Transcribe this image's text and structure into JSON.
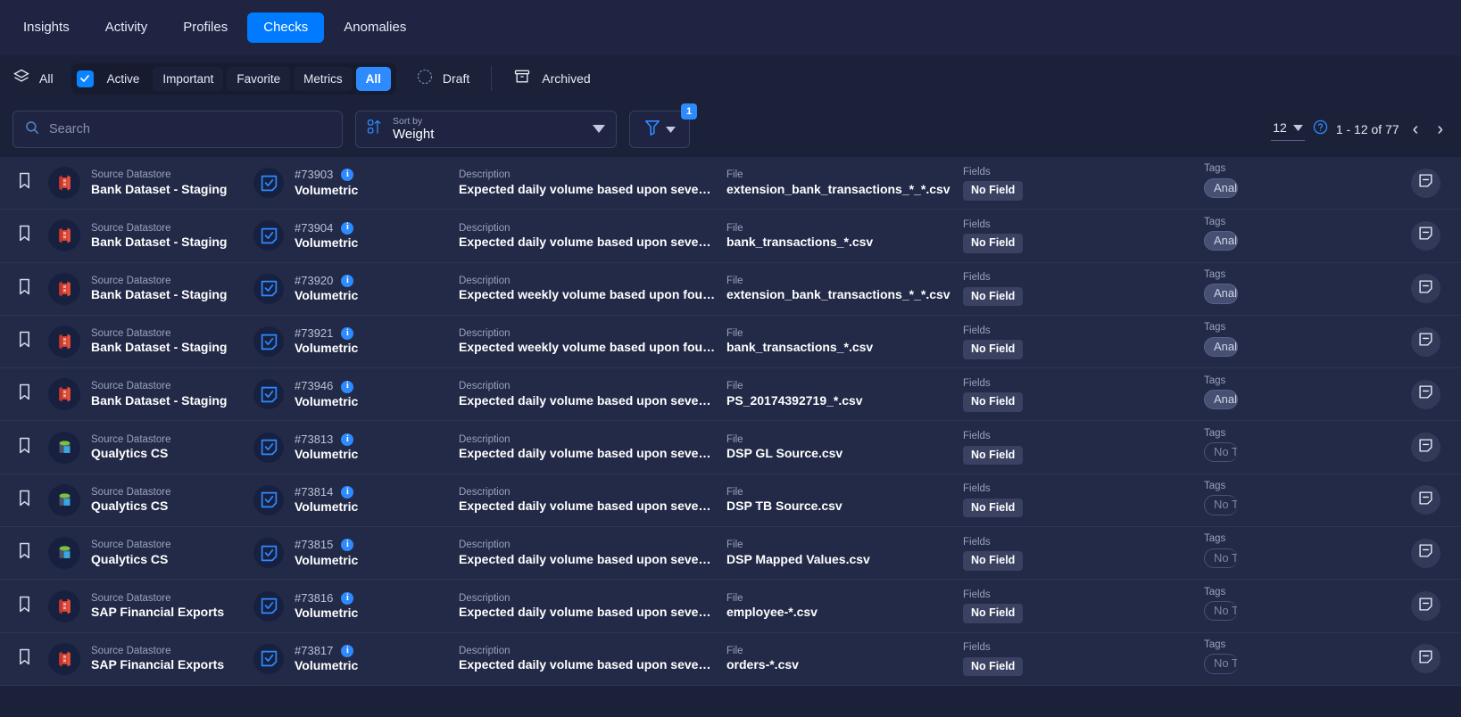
{
  "nav": {
    "tabs": [
      {
        "label": "Insights",
        "active": false
      },
      {
        "label": "Activity",
        "active": false
      },
      {
        "label": "Profiles",
        "active": false
      },
      {
        "label": "Checks",
        "active": true
      },
      {
        "label": "Anomalies",
        "active": false
      }
    ]
  },
  "filterbar": {
    "all_label": "All",
    "segment": [
      "Active",
      "Important",
      "Favorite",
      "Metrics",
      "All"
    ],
    "segment_selected": "All",
    "active_checked": true,
    "draft_label": "Draft",
    "archived_label": "Archived"
  },
  "toolbar": {
    "search_placeholder": "Search",
    "search_value": "",
    "sort_caption": "Sort by",
    "sort_value": "Weight",
    "filter_badge": "1",
    "per_page": "12",
    "range": "1 - 12 of 77"
  },
  "columns": {
    "datastore": "Source Datastore",
    "description": "Description",
    "file": "File",
    "fields": "Fields",
    "tags": "Tags"
  },
  "colors": {
    "accent": "#007bff",
    "page_bg": "#1b2138",
    "row_bg": "#232a47",
    "nav_bg": "#1e2441"
  },
  "rows": [
    {
      "datastore": "Bank Dataset - Staging",
      "ds_icon": "redshift-icon",
      "id": "#73903",
      "type": "Volumetric",
      "description": "Expected daily volume based upon seven day ...",
      "file": "extension_bank_transactions_*_*.csv",
      "fields": "No Field",
      "tag": "Analy",
      "tag_kind": "tag"
    },
    {
      "datastore": "Bank Dataset - Staging",
      "ds_icon": "redshift-icon",
      "id": "#73904",
      "type": "Volumetric",
      "description": "Expected daily volume based upon seven day ...",
      "file": "bank_transactions_*.csv",
      "fields": "No Field",
      "tag": "Analy",
      "tag_kind": "tag"
    },
    {
      "datastore": "Bank Dataset - Staging",
      "ds_icon": "redshift-icon",
      "id": "#73920",
      "type": "Volumetric",
      "description": "Expected weekly volume based upon four wee...",
      "file": "extension_bank_transactions_*_*.csv",
      "fields": "No Field",
      "tag": "Analy",
      "tag_kind": "tag"
    },
    {
      "datastore": "Bank Dataset - Staging",
      "ds_icon": "redshift-icon",
      "id": "#73921",
      "type": "Volumetric",
      "description": "Expected weekly volume based upon four wee...",
      "file": "bank_transactions_*.csv",
      "fields": "No Field",
      "tag": "Analy",
      "tag_kind": "tag"
    },
    {
      "datastore": "Bank Dataset - Staging",
      "ds_icon": "redshift-icon",
      "id": "#73946",
      "type": "Volumetric",
      "description": "Expected daily volume based upon seven day ...",
      "file": "PS_20174392719_*.csv",
      "fields": "No Field",
      "tag": "Analy",
      "tag_kind": "tag"
    },
    {
      "datastore": "Qualytics CS",
      "ds_icon": "database-icon",
      "id": "#73813",
      "type": "Volumetric",
      "description": "Expected daily volume based upon seven day ...",
      "file": "DSP GL Source.csv",
      "fields": "No Field",
      "tag": "No Tag",
      "tag_kind": "empty"
    },
    {
      "datastore": "Qualytics CS",
      "ds_icon": "database-icon",
      "id": "#73814",
      "type": "Volumetric",
      "description": "Expected daily volume based upon seven day ...",
      "file": "DSP TB Source.csv",
      "fields": "No Field",
      "tag": "No Tag",
      "tag_kind": "empty"
    },
    {
      "datastore": "Qualytics CS",
      "ds_icon": "database-icon",
      "id": "#73815",
      "type": "Volumetric",
      "description": "Expected daily volume based upon seven day ...",
      "file": "DSP Mapped Values.csv",
      "fields": "No Field",
      "tag": "No Tag",
      "tag_kind": "empty"
    },
    {
      "datastore": "SAP Financial Exports",
      "ds_icon": "redshift-icon",
      "id": "#73816",
      "type": "Volumetric",
      "description": "Expected daily volume based upon seven day ...",
      "file": "employee-*.csv",
      "fields": "No Field",
      "tag": "No Tag",
      "tag_kind": "empty"
    },
    {
      "datastore": "SAP Financial Exports",
      "ds_icon": "redshift-icon",
      "id": "#73817",
      "type": "Volumetric",
      "description": "Expected daily volume based upon seven day ...",
      "file": "orders-*.csv",
      "fields": "No Field",
      "tag": "No Tag",
      "tag_kind": "empty"
    }
  ]
}
